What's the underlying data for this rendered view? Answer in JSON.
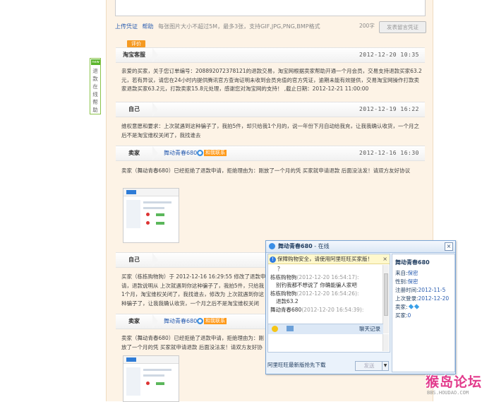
{
  "upload": {
    "upload_link": "上传凭证",
    "help_link": "帮助",
    "hint": "每张图片大小不超过5M，最多3张，支持GIF,JPG,PNG,BMP格式",
    "char_count": "200字",
    "submit_label": "发表留言凭证"
  },
  "tag": {
    "label": "评价"
  },
  "float_tab": {
    "badge": "new",
    "label": "退款在线帮助"
  },
  "messages": [
    {
      "role": "淘宝客服",
      "date": "2012-12-20 10:35",
      "body": "亲爱的买家，关于您订单编号：208892072378121的退款交易，淘宝网根据卖家帮助开通一个月会员，交易支持退款买家63.2元，若有异议，请您在24小时内提供腾讯官方查询证明未收到会员充值的官方凭证，逾期未能有效提供，交易淘宝网操作打款卖家退款买家63.2元，打款卖家15.8元处理，感谢您对淘宝网的支持！ ,截止日期：2012-12-21 11:00:00"
    },
    {
      "role": "自己",
      "date": "2012-12-19 16:22",
      "body": "维权意愿和要求：上次就遇到这种骗子了，我拍5件，却只给我1个月的，说一年份下月自动给我充，让我我确认收货，一个月之后不是淘宝维权关闭了，我找谁去"
    },
    {
      "role": "卖家",
      "nick": "舞动青春680",
      "ww_label": "和我联系",
      "date": "2012-12-16 16:30",
      "body": "卖家（舞动青春680）已经拒绝了退款申请，拒绝理由为：刚放了一个月的凭 买家就申请退款 后面没法发！请双方友好协议"
    },
    {
      "role": "自己",
      "body": "买家（栋栋购物狗）于 2012-12-16 16:29:55 修改了退款申请，退款说明从 上次就遇到你这种骗子了，我拍5件，只给我1个月，淘宝维权关闭了，我找谁去，修改为 上次就遇到你这种骗子了，让我我确认收货，一个月之后不是淘宝维权关闭了，我找谁"
    },
    {
      "role": "卖家",
      "nick": "舞动青春680",
      "ww_label": "和我联系",
      "body": "卖家（舞动青春680）已经拒绝了退款申请，拒绝理由为：刚放了一个月的凭 买家就申请退款 后面没法发！请双方友好协议"
    }
  ],
  "wangwang": {
    "title_name": "舞动青春680",
    "title_status": " - 在线",
    "close": "×",
    "warning": "保障购物安全，请使用阿里旺旺买家版！",
    "lines": [
      {
        "who": "？",
        "ts": "",
        "txt": ""
      },
      {
        "who": "栋栋购物狗",
        "ts": "(2012-12-20 16:54:17):",
        "txt": ""
      },
      {
        "who": "",
        "ts": "",
        "txt": "别钓我都不想说了 你确能骗人家吧"
      },
      {
        "who": "栋栋购物狗",
        "ts": "(2012-12-20 16:54:26):",
        "txt": ""
      },
      {
        "who": "",
        "ts": "",
        "txt": "退款63.2"
      },
      {
        "who": "舞动青春680",
        "ts": "(2012-12-20 16:54:39):",
        "txt": ""
      }
    ],
    "history": "聊天记录",
    "bottom_link": "阿里旺旺最新版抢先下载",
    "send": "发送",
    "profile": {
      "name": "舞动青春680",
      "from_label": "来自:",
      "from_val": "保密",
      "gender_label": "性别:",
      "gender_val": "保密",
      "reg_label": "注册时间:",
      "reg_val": "2012-11-5",
      "login_label": "上次登录:",
      "login_val": "2012-12-20",
      "seller_label": "卖家:",
      "buyer_label": "买家:",
      "buyer_val": "0"
    }
  },
  "watermark": {
    "big": "猴岛论坛",
    "small": "BBS.HOUDAO.COM"
  }
}
